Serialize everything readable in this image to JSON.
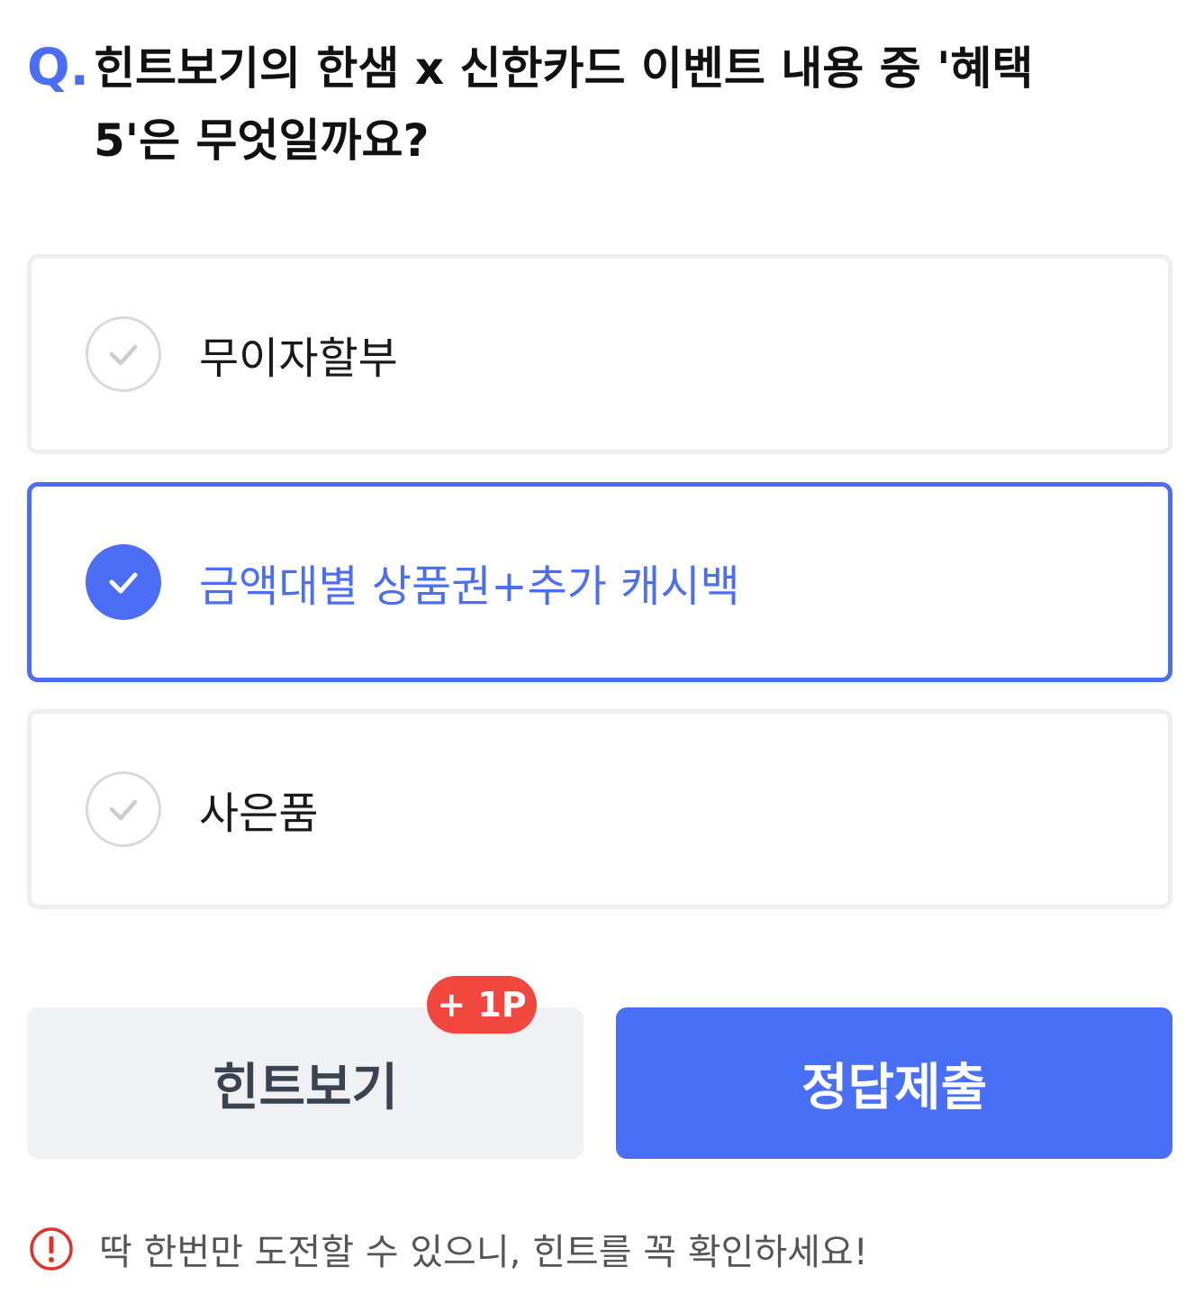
{
  "question": {
    "prefix": "Q.",
    "text": "힌트보기의 한샘 x 신한카드 이벤트 내용 중 '혜택 5'은 무엇일까요?"
  },
  "options": [
    {
      "label": "무이자할부",
      "selected": false
    },
    {
      "label": "금액대별 상품권+추가 캐시백",
      "selected": true
    },
    {
      "label": "사은품",
      "selected": false
    }
  ],
  "actions": {
    "hint_label": "힌트보기",
    "hint_badge": "+ 1P",
    "submit_label": "정답제출"
  },
  "notice": {
    "icon": "exclamation-circle-icon",
    "text": "딱 한번만 도전할 수 있으니, 힌트를 꼭 확인하세요!"
  },
  "colors": {
    "accent": "#4b6ef5",
    "badge": "#f2473f",
    "alert": "#e0312c",
    "hint_button_bg": "#eff1f4"
  }
}
